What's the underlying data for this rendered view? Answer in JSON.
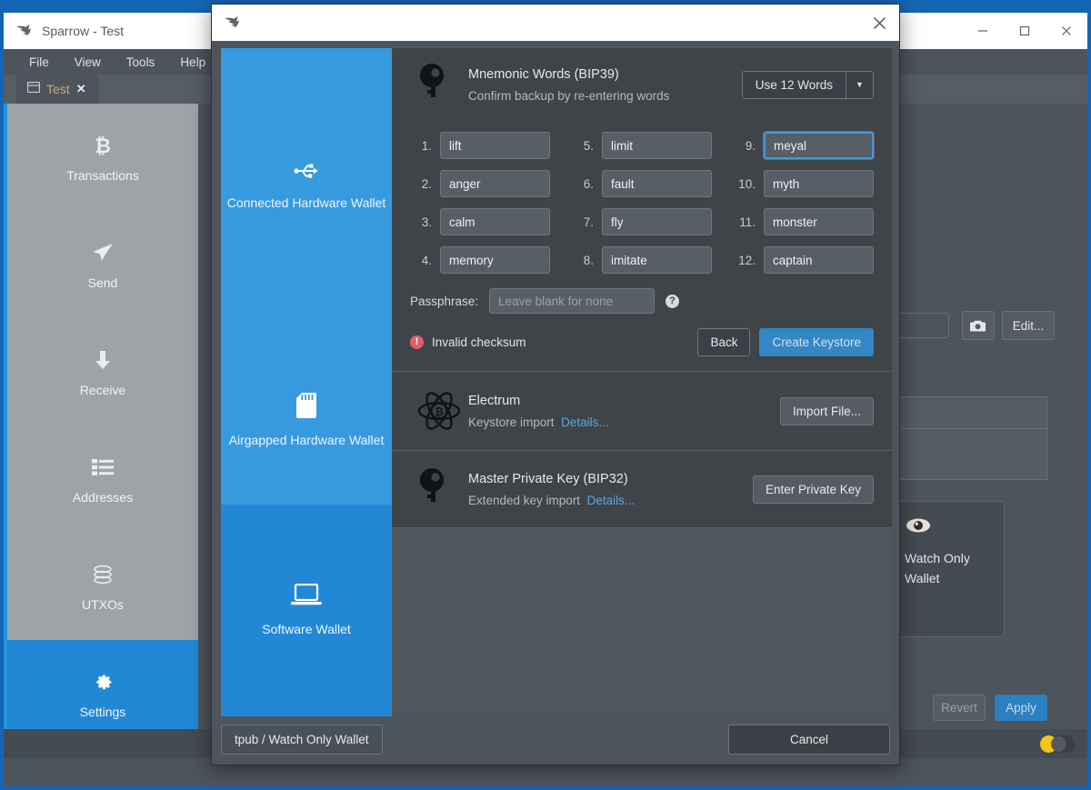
{
  "window": {
    "title": "Sparrow - Test",
    "app_icon": "sparrow-bird-icon",
    "controls": {
      "minimize": "minimize-icon",
      "maximize": "maximize-icon",
      "close": "close-icon"
    }
  },
  "menubar": {
    "items": [
      "File",
      "View",
      "Tools",
      "Help"
    ]
  },
  "tabs": [
    {
      "label": "Test",
      "icon": "wallet-icon",
      "close": "✕"
    }
  ],
  "nav": {
    "items": [
      {
        "label": "Transactions",
        "icon": "bitcoin-icon",
        "active": false
      },
      {
        "label": "Send",
        "icon": "send-icon",
        "active": false
      },
      {
        "label": "Receive",
        "icon": "receive-icon",
        "active": false
      },
      {
        "label": "Addresses",
        "icon": "list-icon",
        "active": false
      },
      {
        "label": "UTXOs",
        "icon": "coins-icon",
        "active": false
      },
      {
        "label": "Settings",
        "icon": "gear-icon",
        "active": true
      }
    ]
  },
  "background_panel": {
    "camera_button": "camera-icon",
    "edit_button": "Edit...",
    "watch_only_card": {
      "icon": "eye-icon",
      "label": "Watch Only Wallet"
    },
    "revert_button": "Revert",
    "apply_button": "Apply",
    "theme_toggle": "theme-toggle"
  },
  "dialog": {
    "title_icon": "sparrow-bird-icon",
    "close": "✕",
    "rail": [
      {
        "label": "Connected Hardware Wallet",
        "icon": "usb-icon",
        "selected": false
      },
      {
        "label": "Airgapped Hardware Wallet",
        "icon": "sdcard-icon",
        "selected": false
      },
      {
        "label": "Software Wallet",
        "icon": "laptop-icon",
        "selected": true
      }
    ],
    "mnemonic_card": {
      "icon": "key-icon",
      "title": "Mnemonic Words (BIP39)",
      "subtitle": "Confirm backup by re-entering words",
      "word_count_selector": {
        "value": "Use 12 Words",
        "arrow": "chevron-down-icon"
      },
      "words": [
        {
          "num": "1.",
          "value": "lift",
          "focused": false
        },
        {
          "num": "2.",
          "value": "anger",
          "focused": false
        },
        {
          "num": "3.",
          "value": "calm",
          "focused": false
        },
        {
          "num": "4.",
          "value": "memory",
          "focused": false
        },
        {
          "num": "5.",
          "value": "limit",
          "focused": false
        },
        {
          "num": "6.",
          "value": "fault",
          "focused": false
        },
        {
          "num": "7.",
          "value": "fly",
          "focused": false
        },
        {
          "num": "8.",
          "value": "imitate",
          "focused": false
        },
        {
          "num": "9.",
          "value": "meyal",
          "focused": true
        },
        {
          "num": "10.",
          "value": "myth",
          "focused": false
        },
        {
          "num": "11.",
          "value": "monster",
          "focused": false
        },
        {
          "num": "12.",
          "value": "captain",
          "focused": false
        }
      ],
      "passphrase": {
        "label": "Passphrase:",
        "value": "",
        "placeholder": "Leave blank for none",
        "help": "?"
      },
      "validation": {
        "icon": "error-icon",
        "text": "Invalid checksum"
      },
      "back_button": "Back",
      "create_button": "Create Keystore"
    },
    "electrum_card": {
      "icon": "electrum-icon",
      "title": "Electrum",
      "subtitle": "Keystore import",
      "details_link": "Details...",
      "action_button": "Import File..."
    },
    "masterkey_card": {
      "icon": "key-icon",
      "title": "Master Private Key (BIP32)",
      "subtitle": "Extended key import",
      "details_link": "Details...",
      "action_button": "Enter Private Key"
    },
    "footer": {
      "left_button": "tpub / Watch Only Wallet",
      "cancel_button": "Cancel"
    }
  },
  "colors": {
    "accent_blue": "#2288d6",
    "rail_blue": "#389ade",
    "window_chrome": "#4d545c",
    "card_bg": "#3f4449",
    "error_red": "#e35d6a",
    "link_blue": "#56a7e0",
    "toggle_yellow": "#f5c518"
  }
}
